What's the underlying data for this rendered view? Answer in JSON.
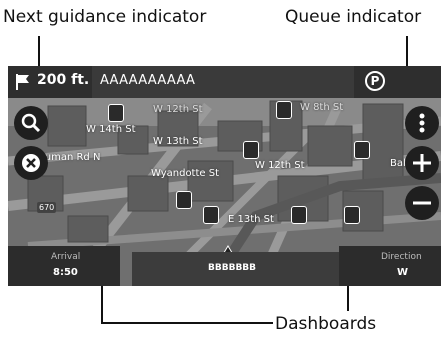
{
  "callouts": {
    "next_guidance": "Next guidance indicator",
    "queue": "Queue indicator",
    "dashboards": "Dashboards"
  },
  "topbar": {
    "distance": "200 ft.",
    "street": "AAAAAAAAAA",
    "queue_icon_letter": "P"
  },
  "map": {
    "labels": [
      "W 12th St",
      "W 8th St",
      "W 14th St",
      "W 13th St",
      "Truman Rd N",
      "W 12th St",
      "Wyandotte St",
      "E 13th St",
      "Balt",
      "670"
    ]
  },
  "bottombar": {
    "arrival_label": "Arrival",
    "arrival_value": "8:50",
    "center": "BBBBBBB",
    "direction_label": "Direction",
    "direction_value": "W"
  },
  "colors": {
    "screen_bg": "#7a7a7a",
    "bar": "#2c2c2c",
    "route": "#6b6b6b"
  },
  "icons": [
    "flag-icon",
    "parking-icon",
    "search-icon",
    "cancel-icon",
    "menu-icon",
    "zoom-in-icon",
    "zoom-out-icon",
    "vehicle-arrow-icon"
  ]
}
